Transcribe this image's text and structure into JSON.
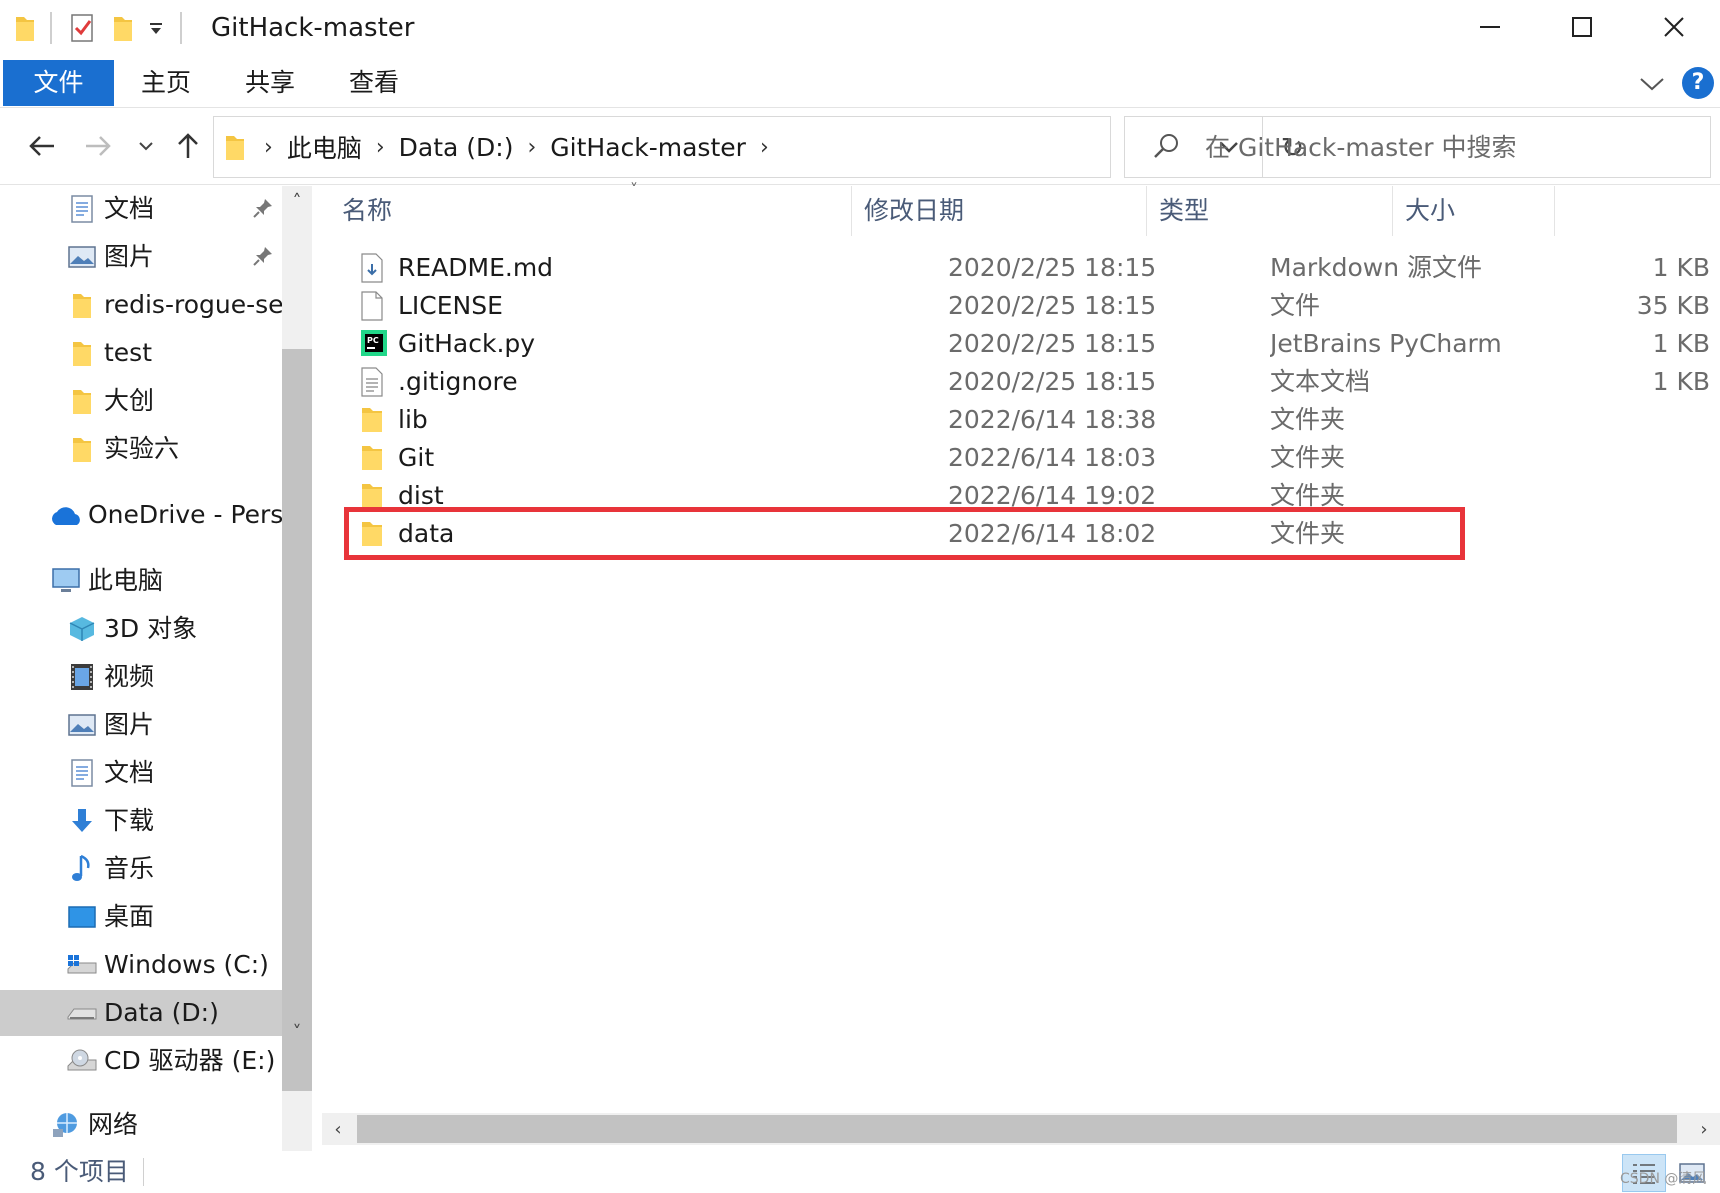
{
  "window": {
    "title": "GitHack-master"
  },
  "ribbon": {
    "tabs": [
      {
        "label": "文件"
      },
      {
        "label": "主页"
      },
      {
        "label": "共享"
      },
      {
        "label": "查看"
      }
    ],
    "accent_color": "#1a6fd0"
  },
  "address": {
    "crumbs": [
      "此电脑",
      "Data (D:)",
      "GitHack-master"
    ]
  },
  "search": {
    "placeholder": "在 GitHack-master 中搜索"
  },
  "sidebar": {
    "items": [
      {
        "label": "文档",
        "icon": "document-icon",
        "pinned": true
      },
      {
        "label": "图片",
        "icon": "picture-icon",
        "pinned": true
      },
      {
        "label": "redis-rogue-ser",
        "icon": "folder-icon"
      },
      {
        "label": "test",
        "icon": "folder-icon"
      },
      {
        "label": "大创",
        "icon": "folder-icon"
      },
      {
        "label": "实验六",
        "icon": "folder-icon"
      },
      {
        "label": "OneDrive - Persc",
        "icon": "onedrive-icon"
      },
      {
        "label": "此电脑",
        "icon": "this-pc-icon"
      },
      {
        "label": "3D 对象",
        "icon": "3d-objects-icon"
      },
      {
        "label": "视频",
        "icon": "video-icon"
      },
      {
        "label": "图片",
        "icon": "picture-icon"
      },
      {
        "label": "文档",
        "icon": "document-icon"
      },
      {
        "label": "下载",
        "icon": "download-icon"
      },
      {
        "label": "音乐",
        "icon": "music-icon"
      },
      {
        "label": "桌面",
        "icon": "desktop-icon"
      },
      {
        "label": "Windows (C:)",
        "icon": "windows-drive-icon"
      },
      {
        "label": "Data (D:)",
        "icon": "drive-icon",
        "selected": true
      },
      {
        "label": "CD 驱动器 (E:)",
        "icon": "cd-drive-icon"
      },
      {
        "label": "网络",
        "icon": "network-icon"
      }
    ]
  },
  "filelist": {
    "columns": {
      "name": "名称",
      "date": "修改日期",
      "type": "类型",
      "size": "大小"
    },
    "rows": [
      {
        "name": "README.md",
        "date": "2020/2/25 18:15",
        "type": "Markdown 源文件",
        "size": "1 KB",
        "icon": "markdown-file-icon"
      },
      {
        "name": "LICENSE",
        "date": "2020/2/25 18:15",
        "type": "文件",
        "size": "35 KB",
        "icon": "blank-file-icon"
      },
      {
        "name": "GitHack.py",
        "date": "2020/2/25 18:15",
        "type": "JetBrains PyCharm ...",
        "size": "1 KB",
        "icon": "pycharm-file-icon"
      },
      {
        "name": ".gitignore",
        "date": "2020/2/25 18:15",
        "type": "文本文档",
        "size": "1 KB",
        "icon": "text-file-icon"
      },
      {
        "name": "lib",
        "date": "2022/6/14 18:38",
        "type": "文件夹",
        "size": "",
        "icon": "folder-icon"
      },
      {
        "name": "Git",
        "date": "2022/6/14 18:03",
        "type": "文件夹",
        "size": "",
        "icon": "folder-icon"
      },
      {
        "name": "dist",
        "date": "2022/6/14 19:02",
        "type": "文件夹",
        "size": "",
        "icon": "folder-icon",
        "highlighted": true
      },
      {
        "name": "data",
        "date": "2022/6/14 18:02",
        "type": "文件夹",
        "size": "",
        "icon": "folder-icon"
      }
    ],
    "highlight_color": "#e8343a"
  },
  "status": {
    "item_count": "8 个项目"
  },
  "watermark": "CSDN @清风"
}
